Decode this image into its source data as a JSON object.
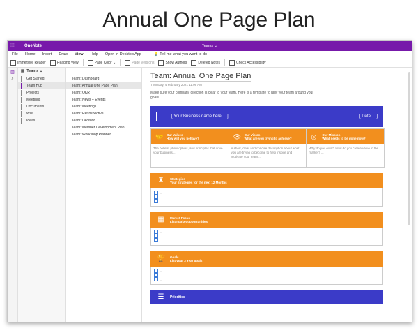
{
  "slide_title": "Annual One Page Plan",
  "window": {
    "app_name": "OneNote",
    "notebook_title": "Teams ⌄",
    "menu": [
      "File",
      "Home",
      "Insert",
      "Draw",
      "View",
      "Help",
      "Open in Desktop App"
    ],
    "tell_me": "Tell me what you want to do",
    "toolbar": {
      "immersive_reader": "Immersive Reader",
      "reading_view": "Reading View",
      "page_color": "Page Color ⌄",
      "page_versions": "Page Versions",
      "show_authors": "Show Authors",
      "deleted_notes": "Deleted Notes",
      "check_accessibility": "Check Accessibility"
    }
  },
  "sidebar": {
    "notebook": "Teams ⌄",
    "sections": [
      "Get Started",
      "Team Hub",
      "Projects",
      "Meetings",
      "Documents",
      "Wiki",
      "Ideas"
    ]
  },
  "pages": [
    "Team: Dashboard",
    "Team: Annual One Page Plan",
    "Team: OKR",
    "Team: News + Events",
    "Team: Meetings",
    "Team: Retrospective",
    "Team: Decision",
    "Team: Member Development Plan",
    "Team: Workshop Planner"
  ],
  "page": {
    "title": "Team: Annual One Page Plan",
    "datetime": "Thursday, 4 February 2021   11:06 AM",
    "intro": "Make sure your company direction is clear to your team. Here is a template to rally your team around your goals.",
    "banner_left": "[ Your Business name here ... ]",
    "banner_right": "[ Date ... ]",
    "values": {
      "title": "Our Values",
      "subtitle": "How will you behave?",
      "body": "The beliefs, philosophies, and principles that drive your business ..."
    },
    "vision": {
      "title": "Our Vision",
      "subtitle": "What are you trying to achieve?",
      "body": "A short, clear and concise description about what you are trying to become to help inspire and motivate your team ..."
    },
    "mission": {
      "title": "Our Mission",
      "subtitle": "What needs to be done now?",
      "body": "Why do you exist? How do you create value in the market? ..."
    },
    "strategies": {
      "title": "Strategies",
      "subtitle": "Your strategies for the next 12 Months"
    },
    "market_focus": {
      "title": "Market Focus",
      "subtitle": "List market opportunities"
    },
    "goals": {
      "title": "Goals",
      "subtitle": "List your 3 Year goals"
    },
    "priorities": {
      "title": "Priorities"
    },
    "placeholder": "..."
  },
  "colors": {
    "purple": "#7719aa",
    "orange": "#f28f1e",
    "blue": "#3b3bc8"
  }
}
